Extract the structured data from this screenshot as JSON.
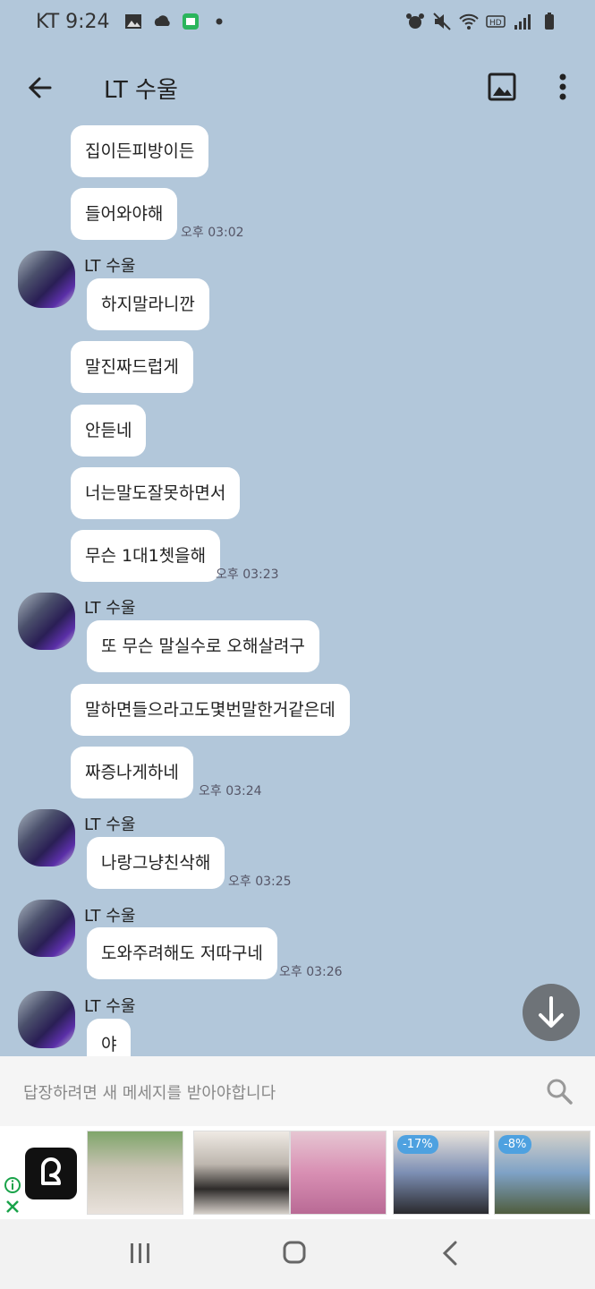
{
  "status_bar": {
    "carrier_time": "KT 9:24",
    "icons_left": [
      "image-icon",
      "cloud-icon",
      "app-icon",
      "dot-icon"
    ],
    "icons_right": [
      "alarm-icon",
      "mute-icon",
      "wifi-icon",
      "hd-icon",
      "signal-icon",
      "battery-icon"
    ]
  },
  "header": {
    "title": "LT 수울",
    "back_icon": "arrow-left-icon",
    "gallery_icon": "image-icon",
    "more_icon": "more-vertical-icon"
  },
  "messages": [
    {
      "text": "집이든피방이든"
    },
    {
      "text": "들어와야해",
      "time": "오후 03:02"
    },
    {
      "sender": "LT 수울",
      "text": "하지말라니깐"
    },
    {
      "text": "말진짜드럽게"
    },
    {
      "text": "안듣네"
    },
    {
      "text": "너는말도잘못하면서"
    },
    {
      "text": "무슨 1대1쳇을해",
      "time": "오후 03:23"
    },
    {
      "sender": "LT 수울",
      "text": "또 무슨 말실수로 오해살려구"
    },
    {
      "text": "말하면들으라고도몇번말한거같은데"
    },
    {
      "text": "짜증나게하네",
      "time": "오후 03:24"
    },
    {
      "sender": "LT 수울",
      "text": "나랑그냥친삭해",
      "time": "오후 03:25"
    },
    {
      "sender": "LT 수울",
      "text": "도와주려해도 저따구네",
      "time": "오후 03:26"
    },
    {
      "sender": "LT 수울",
      "text": "야"
    }
  ],
  "input_bar": {
    "placeholder": "답장하려면 새 메세지를 받아야합니다"
  },
  "ad": {
    "badges": [
      "-17%",
      "-8%"
    ]
  },
  "colors": {
    "chat_background": "#b2c7da",
    "bubble": "#ffffff",
    "scroll_button": "#6e7378"
  }
}
